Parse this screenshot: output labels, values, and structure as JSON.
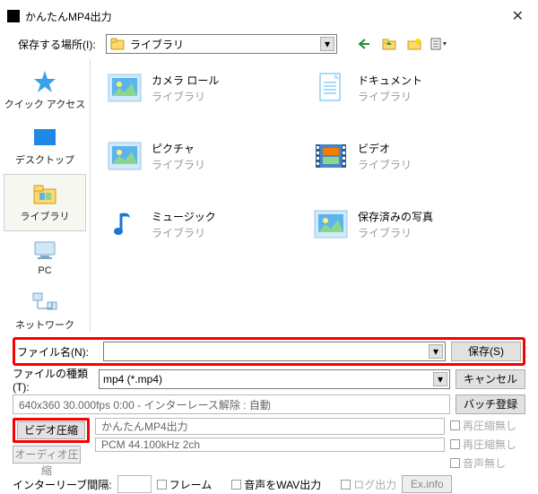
{
  "window": {
    "title": "かんたんMP4出力"
  },
  "saveIn": {
    "label": "保存する場所(I):",
    "value": "ライブラリ"
  },
  "sidebar": {
    "items": [
      {
        "label": "クイック アクセス"
      },
      {
        "label": "デスクトップ"
      },
      {
        "label": "ライブラリ"
      },
      {
        "label": "PC"
      },
      {
        "label": "ネットワーク"
      }
    ]
  },
  "files": {
    "subLabel": "ライブラリ",
    "items": [
      {
        "name": "カメラ ロール"
      },
      {
        "name": "ドキュメント"
      },
      {
        "name": "ピクチャ"
      },
      {
        "name": "ビデオ"
      },
      {
        "name": "ミュージック"
      },
      {
        "name": "保存済みの写真"
      }
    ]
  },
  "form": {
    "filenameLabel": "ファイル名(N):",
    "filenameValue": "",
    "saveBtn": "保存(S)",
    "filetypeLabel": "ファイルの種類(T):",
    "filetypeValue": "mp4 (*.mp4)",
    "cancelBtn": "キャンセル",
    "infoLine": "640x360  30.000fps  0:00  -  インターレース解除 : 自動",
    "batchBtn": "バッチ登録",
    "videoCompBtn": "ビデオ圧縮",
    "videoCompValue": "かんたんMP4出力",
    "audioCompBtn": "オーディオ圧縮",
    "audioCompValue": "PCM 44.100kHz 2ch",
    "noRecompress": "再圧縮無し",
    "noAudio": "音声無し",
    "interleaveLabel": "インターリーブ間隔:",
    "interleaveFrames": "フレーム",
    "wavOut": "音声をWAV出力",
    "logOut": "ログ出力",
    "exInfo": "Ex.info"
  }
}
